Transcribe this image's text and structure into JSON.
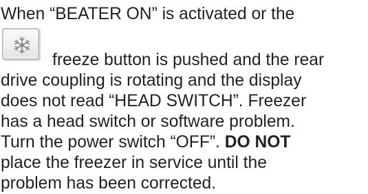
{
  "paragraph": {
    "line1": "When “BEATER ON” is activated or the",
    "line2": "freeze button is pushed and the rear",
    "line3": "drive coupling is rotating and the display",
    "line4": "does not read “HEAD SWITCH”. Freezer",
    "line5": "has a head switch or software problem.",
    "line6_pre": "Turn the power switch  “OFF”. ",
    "line6_bold": "DO NOT",
    "line7": "place the freezer in service until the",
    "line8": "problem has been corrected."
  },
  "freeze_button_icon": "snowflake-icon",
  "colors": {
    "text": "#231f20",
    "icon_border": "#bfbfbf",
    "icon_glyph": "#8a8a8a"
  }
}
